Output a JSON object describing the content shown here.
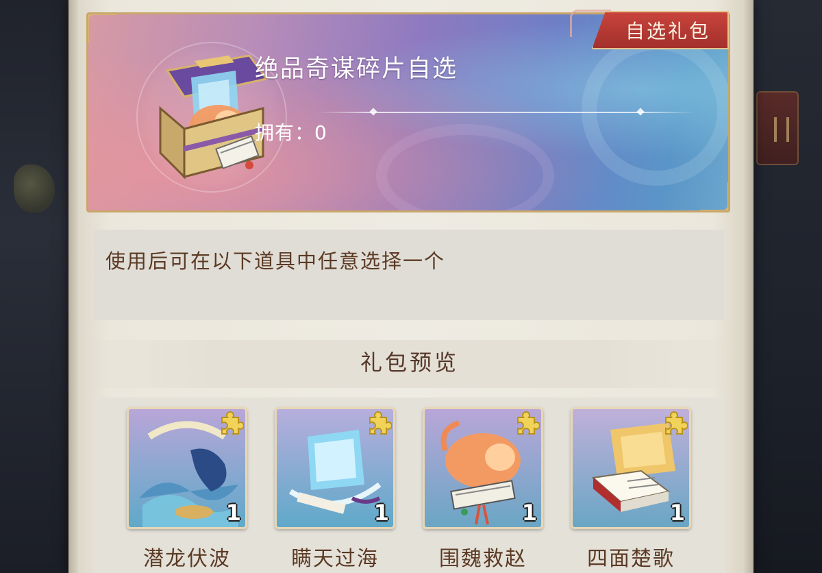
{
  "banner": {
    "tag": "自选礼包",
    "title": "绝品奇谋碎片自选",
    "owned_label": "拥有：",
    "owned_count": "0",
    "icon": "treasure-chest-icon"
  },
  "description": "使用后可在以下道具中任意选择一个",
  "preview": {
    "heading": "礼包预览",
    "items": [
      {
        "name": "潜龙伏波",
        "quantity": "1",
        "icon": "dragon-wave-icon",
        "badge": "puzzle-piece-icon"
      },
      {
        "name": "瞒天过海",
        "quantity": "1",
        "icon": "ship-sea-icon",
        "badge": "puzzle-piece-icon"
      },
      {
        "name": "围魏救赵",
        "quantity": "1",
        "icon": "horse-rider-icon",
        "badge": "puzzle-piece-icon"
      },
      {
        "name": "四面楚歌",
        "quantity": "1",
        "icon": "book-scroll-icon",
        "badge": "puzzle-piece-icon"
      }
    ]
  },
  "colors": {
    "paper": "#eeebe2",
    "text_brown": "#5b3a24",
    "tag_red": "#b8372f",
    "gold_border": "#c9a66a"
  }
}
